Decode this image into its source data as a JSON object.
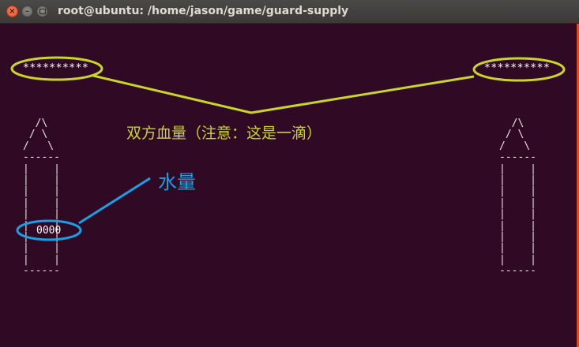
{
  "window": {
    "title": "root@ubuntu: /home/jason/game/guard-supply",
    "close_glyph": "×",
    "minimize_glyph": "–"
  },
  "game": {
    "left_hp": "**********",
    "right_hp": "**********",
    "left_tower": "  /\\\n / \\\n/   \\\n------\n|    |\n|    |\n|    |\n|    |\n|    |\n|    |\n|    |\n|    |\n|    |\n------",
    "right_tower": "  /\\\n / \\\n/   \\\n------\n|    |\n|    |\n|    |\n|    |\n|    |\n|    |\n|    |\n|    |\n|    |\n------",
    "water_value": "0000"
  },
  "annotations": {
    "hp_note": "双方血量（注意：这是一滴）",
    "water_note": "水量",
    "hp_color": "#c8d62a",
    "water_color": "#1aa0e6"
  }
}
